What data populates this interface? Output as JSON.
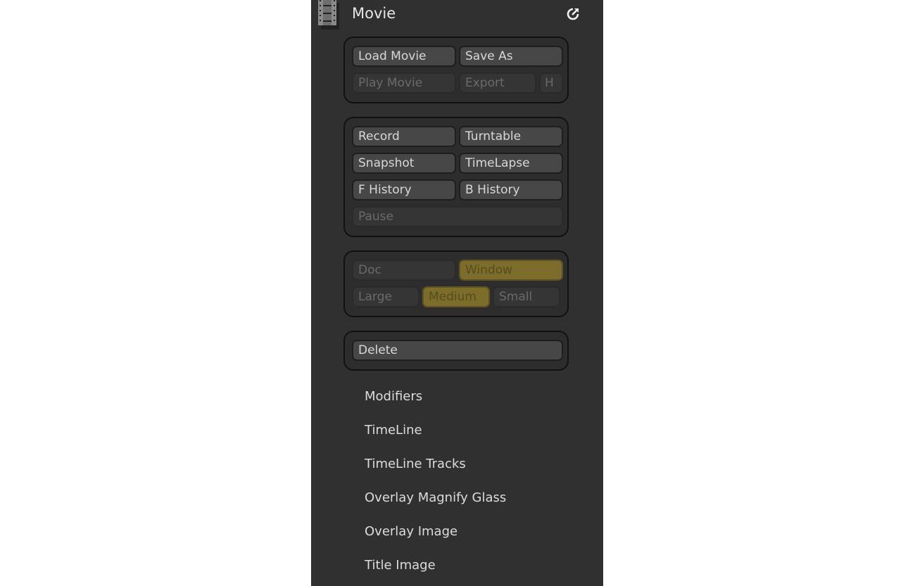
{
  "panel": {
    "title": "Movie",
    "icons": {
      "header": "film-strip-icon",
      "popout": "popout-icon"
    },
    "colors": {
      "background": "#303030",
      "active_toggle": "#7d6d2a"
    }
  },
  "file_group": {
    "load_movie": "Load Movie",
    "save_as": "Save As",
    "play_movie": "Play Movie",
    "export": "Export",
    "h": "H"
  },
  "record_group": {
    "record": "Record",
    "turntable": "Turntable",
    "snapshot": "Snapshot",
    "timelapse": "TimeLapse",
    "f_history": "F History",
    "b_history": "B History",
    "pause": "Pause"
  },
  "size_group": {
    "doc": "Doc",
    "window": "Window",
    "large": "Large",
    "medium": "Medium",
    "small": "Small",
    "selected_source": "Window",
    "selected_size": "Medium"
  },
  "delete_group": {
    "delete": "Delete"
  },
  "subpalettes": [
    "Modifiers",
    "TimeLine",
    "TimeLine Tracks",
    "Overlay Magnify Glass",
    "Overlay Image",
    "Title Image"
  ]
}
